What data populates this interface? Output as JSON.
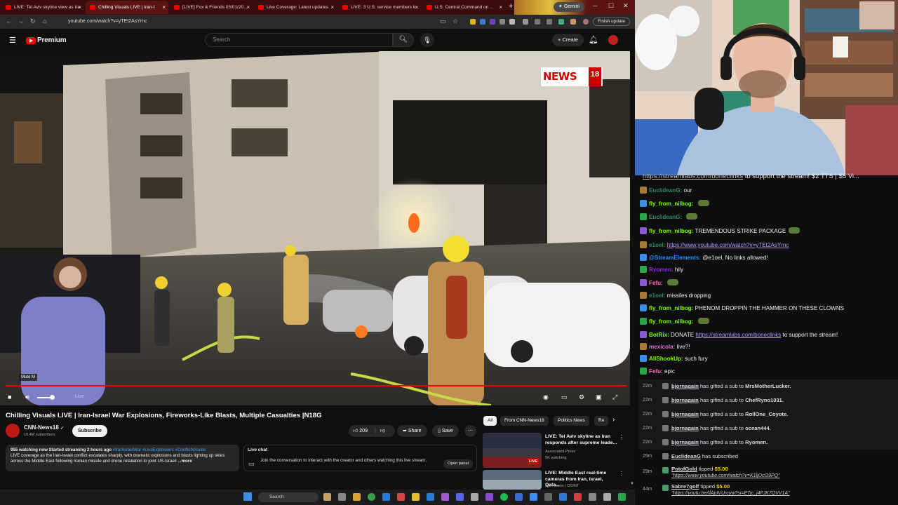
{
  "browser": {
    "tabs": [
      {
        "title": "LIVE: Tel Aviv skyline view as Ira"
      },
      {
        "title": "Chilling Visuals LIVE | Iran-I",
        "active": true
      },
      {
        "title": "[LIVE] Fox & Friends 03/01/20..."
      },
      {
        "title": "Live Coverage: Latest updates"
      },
      {
        "title": "LIVE: 3 U.S. service members k..."
      },
      {
        "title": "U.S. Central Command on ..."
      }
    ],
    "new_tab": "+",
    "gemini": "Gemini",
    "url": "youtube.com/watch?v=yTEt2AsYrnc",
    "finish_update": "Finish update"
  },
  "youtube": {
    "logo": "Premium",
    "search_placeholder": "Search",
    "create": "Create"
  },
  "player": {
    "news_logo": "NEWS",
    "news_num": "18",
    "mute_tooltip": "Mute  M",
    "live_label": "Live",
    "volume_level": 0.8
  },
  "video": {
    "title": "Chilling Visuals LIVE | Iran-Israel War Explosions, Fireworks-Like Blasts, Multiple Casualties |N18G",
    "channel": "CNN-News18",
    "subscribers": "10.4M subscribers",
    "subscribe": "Subscribe",
    "likes": "209",
    "share": "Share",
    "save": "Save"
  },
  "description": {
    "stats": "955 watching now  Started streaming 2 hours ago",
    "tags": "#IranIsraelWar #LiveExplosions #ConflictVisuals",
    "text": "LIVE coverage as the Iran-Israel conflict escalates sharply, with dramatic explosions and blasts lighting up skies across the Middle East following Iranian missile and drone retaliation to joint US-Israeli",
    "more": "...more"
  },
  "live_chat": {
    "title": "Live chat",
    "text": "Join the conversation to interact with the creator and others watching this live stream.",
    "button": "Open panel"
  },
  "chips": [
    "All",
    "From CNN-News18",
    "Politics News",
    "Re"
  ],
  "recs": [
    {
      "title": "LIVE: Tel Aviv skyline as Iran responds after supreme leade...",
      "channel": "Associated Press",
      "meta": "5K watching",
      "badge": "LIVE"
    },
    {
      "title": "LIVE: Middle East real-time cameras from Iran, Israel, Qata...",
      "channel": "Intel Cams | OSINT",
      "meta": ""
    }
  ],
  "taskbar": {
    "search": "Search"
  },
  "chat": {
    "pinned_prefix": "https://streamlabs.com/boneclinks",
    "pinned_suffix": " to support the stream! $2 TTS | $5 Vi...",
    "messages": [
      {
        "user": "EuclideanG",
        "color": "#2e8b57",
        "text": "our"
      },
      {
        "user": "fly_from_nilbog",
        "color": "#7cfc00",
        "text": "",
        "emote": true
      },
      {
        "user": "EuclideanG",
        "color": "#2e8b57",
        "text": "",
        "emote": true
      },
      {
        "user": "fly_from_nilbog",
        "color": "#7cfc00",
        "text": "TREMENDOUS STRIKE PACKAGE",
        "emote": true
      },
      {
        "user": "e1oel",
        "color": "#2e8b57",
        "text": "",
        "link": "https://www.youtube.com/watch?v=yTEt2AsYrnc"
      },
      {
        "user": "@StreamElements",
        "color": "#1e90ff",
        "text": "@e1oel, No links allowed!"
      },
      {
        "user": "Ryomen",
        "color": "#8a2be2",
        "text": "hily"
      },
      {
        "user": "Fefu",
        "color": "#ff69b4",
        "text": "",
        "emote": true
      },
      {
        "user": "e1oel",
        "color": "#2e8b57",
        "text": "missiles dropping"
      },
      {
        "user": "fly_from_nilbog",
        "color": "#7cfc00",
        "text": "PHENOM DROPPIN THE HAMMER ON THESE CLOWNS"
      },
      {
        "user": "fly_from_nilbog",
        "color": "#7cfc00",
        "text": "",
        "emote": true
      },
      {
        "user": "BotRix",
        "color": "#7cfc00",
        "text": "DONATE ",
        "link": "https://streamlabs.com/boneclinks",
        "after": " to support the stream!"
      },
      {
        "user": "mexicola",
        "color": "#da70d6",
        "text": "live?!"
      },
      {
        "user": "AllShookUp",
        "color": "#7cfc00",
        "text": "such fury"
      },
      {
        "user": "Fefu",
        "color": "#ff69b4",
        "text": "epic"
      }
    ],
    "events": [
      {
        "time": "22m",
        "user": "bjornagain",
        "text": " has gifted a sub to ",
        "target": "MrsMotherLucker."
      },
      {
        "time": "22m",
        "user": "bjornagain",
        "text": " has gifted a sub to ",
        "target": "ChefRyno1031."
      },
      {
        "time": "22m",
        "user": "bjornagain",
        "text": " has gifted a sub to ",
        "target": "RollOne_Coyote."
      },
      {
        "time": "22m",
        "user": "bjornagain",
        "text": " has gifted a sub to ",
        "target": "ocean444."
      },
      {
        "time": "22m",
        "user": "bjornagain",
        "text": " has gifted a sub to ",
        "target": "Ryomen."
      },
      {
        "time": "29m",
        "user": "EuclideanG",
        "text": " has subscribed",
        "target": ""
      }
    ],
    "tips": [
      {
        "time": "29m",
        "user": "PotofGold",
        "text": " tipped ",
        "amount": "$5.00",
        "link": "\"https://www.youtube.com/watch?v=K1ljOcl39PQ\""
      },
      {
        "time": "44m",
        "user": "Sabre7golf",
        "text": " tipped ",
        "amount": "$5.00",
        "link": "\"https://youtu.be/IlApIVUrcyw?si=E7jc_j4FJK7QVV1A\""
      }
    ]
  },
  "colors": {
    "accent": "#ff0000",
    "chat_bg": "#0e0e10",
    "yt_bg": "#0f0f0f"
  }
}
